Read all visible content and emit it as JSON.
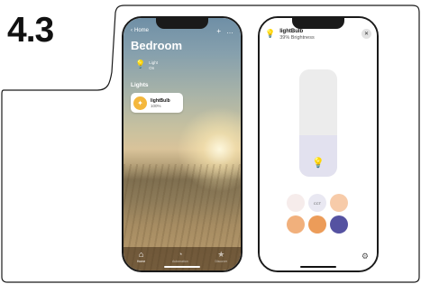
{
  "step": "4.3",
  "home_app": {
    "back_label": "Home",
    "room_title": "Bedroom",
    "light_status": {
      "name": "Light",
      "state": "On"
    },
    "section_label": "Lights",
    "accessory": {
      "name": "lightBulb",
      "value": "100%"
    },
    "tabs": [
      {
        "label": "Home",
        "icon": "house-icon",
        "active": true
      },
      {
        "label": "Automation",
        "icon": "clock-icon",
        "active": false
      },
      {
        "label": "Discover",
        "icon": "star-icon",
        "active": false
      }
    ],
    "add_glyph": "+",
    "more_glyph": "…"
  },
  "detail": {
    "name": "lightBulb",
    "subtitle": "39% Brightness",
    "brightness_fraction": 0.39,
    "close_glyph": "✕",
    "swatches": [
      {
        "color": "#f6eceb",
        "label": ""
      },
      {
        "color": "#e9e8f2",
        "label": "CCT"
      },
      {
        "color": "#f7cba9",
        "label": ""
      },
      {
        "color": "#f1b07c",
        "label": ""
      },
      {
        "color": "#ec9c59",
        "label": ""
      },
      {
        "color": "#5552a1",
        "label": ""
      }
    ]
  },
  "colors": {
    "accent_yellow": "#f4b73c",
    "outline": "#1a1a1a"
  }
}
